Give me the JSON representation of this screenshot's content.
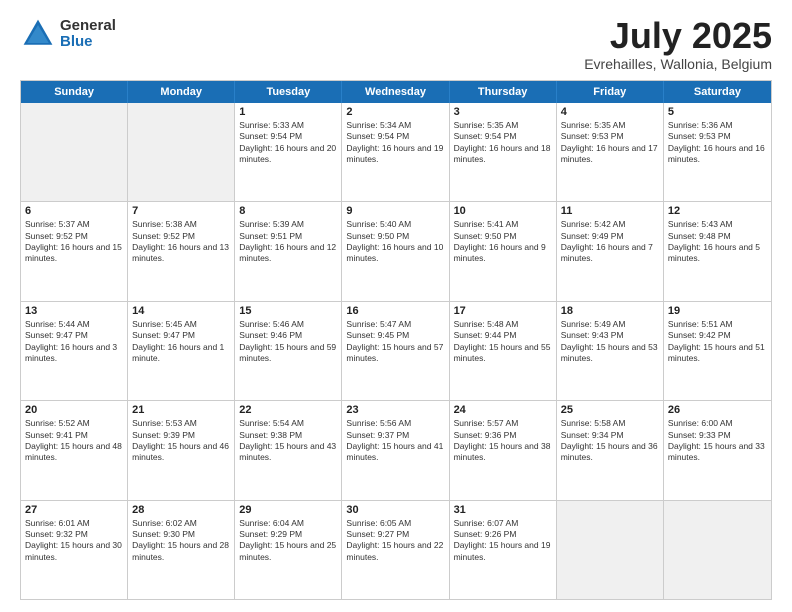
{
  "header": {
    "logo_general": "General",
    "logo_blue": "Blue",
    "month": "July 2025",
    "location": "Evrehailles, Wallonia, Belgium"
  },
  "days_of_week": [
    "Sunday",
    "Monday",
    "Tuesday",
    "Wednesday",
    "Thursday",
    "Friday",
    "Saturday"
  ],
  "weeks": [
    [
      {
        "day": "",
        "info": "",
        "shaded": true
      },
      {
        "day": "",
        "info": "",
        "shaded": true
      },
      {
        "day": "1",
        "info": "Sunrise: 5:33 AM\nSunset: 9:54 PM\nDaylight: 16 hours and 20 minutes."
      },
      {
        "day": "2",
        "info": "Sunrise: 5:34 AM\nSunset: 9:54 PM\nDaylight: 16 hours and 19 minutes."
      },
      {
        "day": "3",
        "info": "Sunrise: 5:35 AM\nSunset: 9:54 PM\nDaylight: 16 hours and 18 minutes."
      },
      {
        "day": "4",
        "info": "Sunrise: 5:35 AM\nSunset: 9:53 PM\nDaylight: 16 hours and 17 minutes."
      },
      {
        "day": "5",
        "info": "Sunrise: 5:36 AM\nSunset: 9:53 PM\nDaylight: 16 hours and 16 minutes."
      }
    ],
    [
      {
        "day": "6",
        "info": "Sunrise: 5:37 AM\nSunset: 9:52 PM\nDaylight: 16 hours and 15 minutes."
      },
      {
        "day": "7",
        "info": "Sunrise: 5:38 AM\nSunset: 9:52 PM\nDaylight: 16 hours and 13 minutes."
      },
      {
        "day": "8",
        "info": "Sunrise: 5:39 AM\nSunset: 9:51 PM\nDaylight: 16 hours and 12 minutes."
      },
      {
        "day": "9",
        "info": "Sunrise: 5:40 AM\nSunset: 9:50 PM\nDaylight: 16 hours and 10 minutes."
      },
      {
        "day": "10",
        "info": "Sunrise: 5:41 AM\nSunset: 9:50 PM\nDaylight: 16 hours and 9 minutes."
      },
      {
        "day": "11",
        "info": "Sunrise: 5:42 AM\nSunset: 9:49 PM\nDaylight: 16 hours and 7 minutes."
      },
      {
        "day": "12",
        "info": "Sunrise: 5:43 AM\nSunset: 9:48 PM\nDaylight: 16 hours and 5 minutes."
      }
    ],
    [
      {
        "day": "13",
        "info": "Sunrise: 5:44 AM\nSunset: 9:47 PM\nDaylight: 16 hours and 3 minutes."
      },
      {
        "day": "14",
        "info": "Sunrise: 5:45 AM\nSunset: 9:47 PM\nDaylight: 16 hours and 1 minute."
      },
      {
        "day": "15",
        "info": "Sunrise: 5:46 AM\nSunset: 9:46 PM\nDaylight: 15 hours and 59 minutes."
      },
      {
        "day": "16",
        "info": "Sunrise: 5:47 AM\nSunset: 9:45 PM\nDaylight: 15 hours and 57 minutes."
      },
      {
        "day": "17",
        "info": "Sunrise: 5:48 AM\nSunset: 9:44 PM\nDaylight: 15 hours and 55 minutes."
      },
      {
        "day": "18",
        "info": "Sunrise: 5:49 AM\nSunset: 9:43 PM\nDaylight: 15 hours and 53 minutes."
      },
      {
        "day": "19",
        "info": "Sunrise: 5:51 AM\nSunset: 9:42 PM\nDaylight: 15 hours and 51 minutes."
      }
    ],
    [
      {
        "day": "20",
        "info": "Sunrise: 5:52 AM\nSunset: 9:41 PM\nDaylight: 15 hours and 48 minutes."
      },
      {
        "day": "21",
        "info": "Sunrise: 5:53 AM\nSunset: 9:39 PM\nDaylight: 15 hours and 46 minutes."
      },
      {
        "day": "22",
        "info": "Sunrise: 5:54 AM\nSunset: 9:38 PM\nDaylight: 15 hours and 43 minutes."
      },
      {
        "day": "23",
        "info": "Sunrise: 5:56 AM\nSunset: 9:37 PM\nDaylight: 15 hours and 41 minutes."
      },
      {
        "day": "24",
        "info": "Sunrise: 5:57 AM\nSunset: 9:36 PM\nDaylight: 15 hours and 38 minutes."
      },
      {
        "day": "25",
        "info": "Sunrise: 5:58 AM\nSunset: 9:34 PM\nDaylight: 15 hours and 36 minutes."
      },
      {
        "day": "26",
        "info": "Sunrise: 6:00 AM\nSunset: 9:33 PM\nDaylight: 15 hours and 33 minutes."
      }
    ],
    [
      {
        "day": "27",
        "info": "Sunrise: 6:01 AM\nSunset: 9:32 PM\nDaylight: 15 hours and 30 minutes."
      },
      {
        "day": "28",
        "info": "Sunrise: 6:02 AM\nSunset: 9:30 PM\nDaylight: 15 hours and 28 minutes."
      },
      {
        "day": "29",
        "info": "Sunrise: 6:04 AM\nSunset: 9:29 PM\nDaylight: 15 hours and 25 minutes."
      },
      {
        "day": "30",
        "info": "Sunrise: 6:05 AM\nSunset: 9:27 PM\nDaylight: 15 hours and 22 minutes."
      },
      {
        "day": "31",
        "info": "Sunrise: 6:07 AM\nSunset: 9:26 PM\nDaylight: 15 hours and 19 minutes."
      },
      {
        "day": "",
        "info": "",
        "shaded": true
      },
      {
        "day": "",
        "info": "",
        "shaded": true
      }
    ]
  ]
}
